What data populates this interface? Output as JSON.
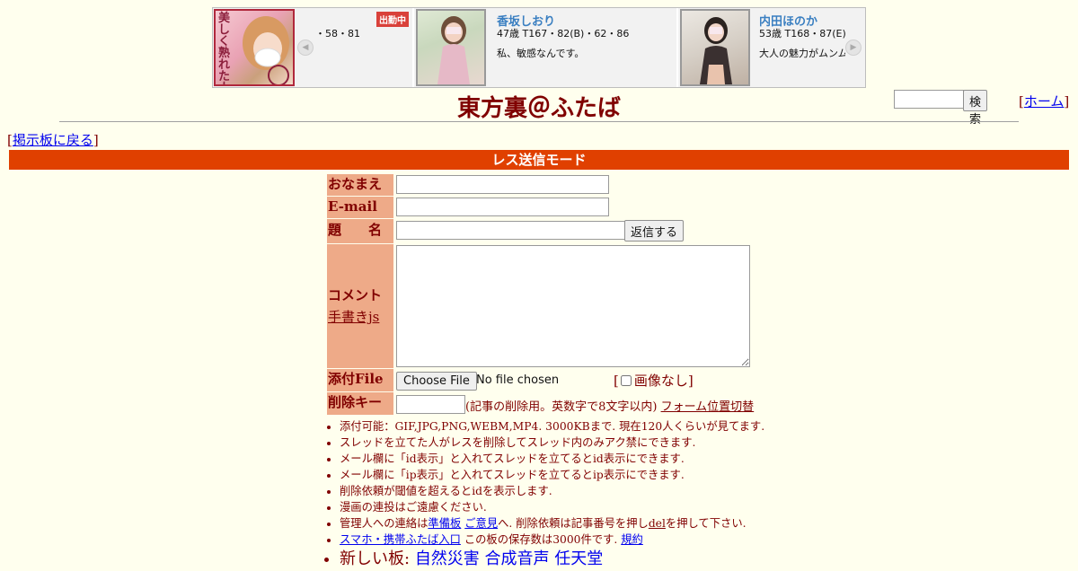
{
  "ad": {
    "card1": {
      "stats": "・58・81",
      "badge": "出勤中",
      "photo_text": "美しく熟れた人妻"
    },
    "card2": {
      "name": "香坂しおり",
      "stats": "47歳 T167・82(B)・62・86",
      "message": "私、敏感なんです。"
    },
    "card3": {
      "name": "内田ほのか",
      "stats": "53歳 T168・87(E)",
      "message": "大人の魅力がムンム"
    }
  },
  "header": {
    "title": "東方裏＠ふたば",
    "search_button": "検索",
    "home_link": "ホーム",
    "back_link": "掲示板に戻る"
  },
  "mode_bar": "レス送信モード",
  "form": {
    "name_label": "おなまえ",
    "email_label": "E-mail",
    "subject_label": "題　　名",
    "submit_button": "返信する",
    "comment_label": "コメント",
    "handwrite_link": "手書きjs",
    "file_label": "添付File",
    "file_button": "Choose File",
    "file_status": "No file chosen",
    "no_image_label": "画像なし",
    "delkey_label": "削除キー",
    "delkey_note": "(記事の削除用。英数字で8文字以内)",
    "form_toggle_link": "フォーム位置切替"
  },
  "rules": {
    "r1": "添付可能：GIF,JPG,PNG,WEBM,MP4. 3000KBまで. 現在120人くらいが見てます.",
    "r2": "スレッドを立てた人がレスを削除してスレッド内のみアク禁にできます.",
    "r3": "メール欄に「id表示」と入れてスレッドを立てるとid表示にできます.",
    "r4": "メール欄に「ip表示」と入れてスレッドを立てるとip表示にできます.",
    "r5": "削除依頼が閾値を超えるとidを表示します.",
    "r6": "漫画の連投はご遠慮ください.",
    "r7": {
      "prefix": "管理人への連絡は",
      "link1": "準備板",
      "link2": "ご意見",
      "middle": "へ. 削除依頼は記事番号を押し",
      "del": "del",
      "suffix": "を押して下さい."
    },
    "r8": {
      "link": "スマホ・携帯ふたば入口",
      "text": "この板の保存数は3000件です.",
      "rules_link": "規約"
    },
    "r9": {
      "prefix": "新しい板:",
      "boards": [
        "自然災害",
        "合成音声",
        "任天堂"
      ]
    }
  }
}
